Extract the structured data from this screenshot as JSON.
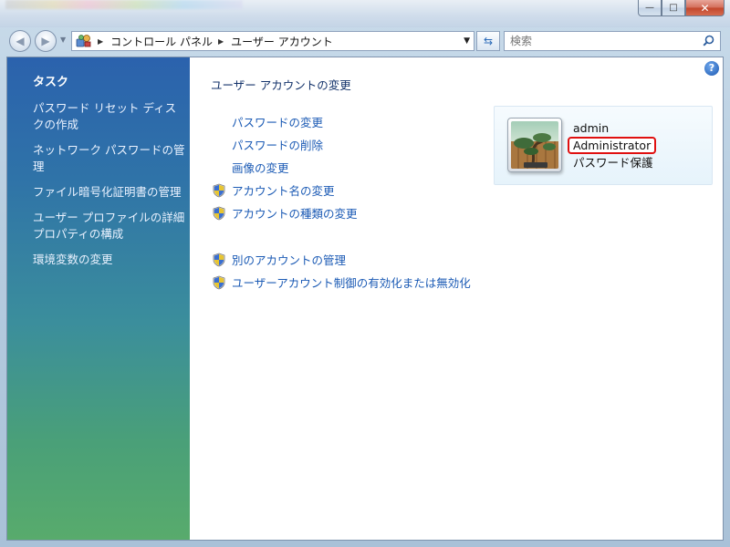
{
  "window": {
    "minimize_glyph": "—",
    "maximize_glyph": "□",
    "close_glyph": "✕"
  },
  "addressbar": {
    "breadcrumbs": [
      "コントロール パネル",
      "ユーザー アカウント"
    ],
    "search_placeholder": "検索"
  },
  "sidebar": {
    "heading": "タスク",
    "tasks": [
      "パスワード リセット ディスクの作成",
      "ネットワーク パスワードの管理",
      "ファイル暗号化証明書の管理",
      "ユーザー プロファイルの詳細プロパティの構成",
      "環境変数の変更"
    ]
  },
  "main": {
    "title": "ユーザー アカウントの変更",
    "links_group1": [
      {
        "label": "パスワードの変更",
        "shield": false
      },
      {
        "label": "パスワードの削除",
        "shield": false
      },
      {
        "label": "画像の変更",
        "shield": false
      },
      {
        "label": "アカウント名の変更",
        "shield": true
      },
      {
        "label": "アカウントの種類の変更",
        "shield": true
      }
    ],
    "links_group2": [
      {
        "label": "別のアカウントの管理",
        "shield": true
      },
      {
        "label": "ユーザーアカウント制御の有効化または無効化",
        "shield": true
      }
    ]
  },
  "account": {
    "username": "admin",
    "type": "Administrator",
    "status": "パスワード保護",
    "highlight_color": "#e01010"
  },
  "colors": {
    "link": "#1c5bb5",
    "sidebar_top": "#2b62ad",
    "sidebar_bottom": "#58ab6c"
  }
}
